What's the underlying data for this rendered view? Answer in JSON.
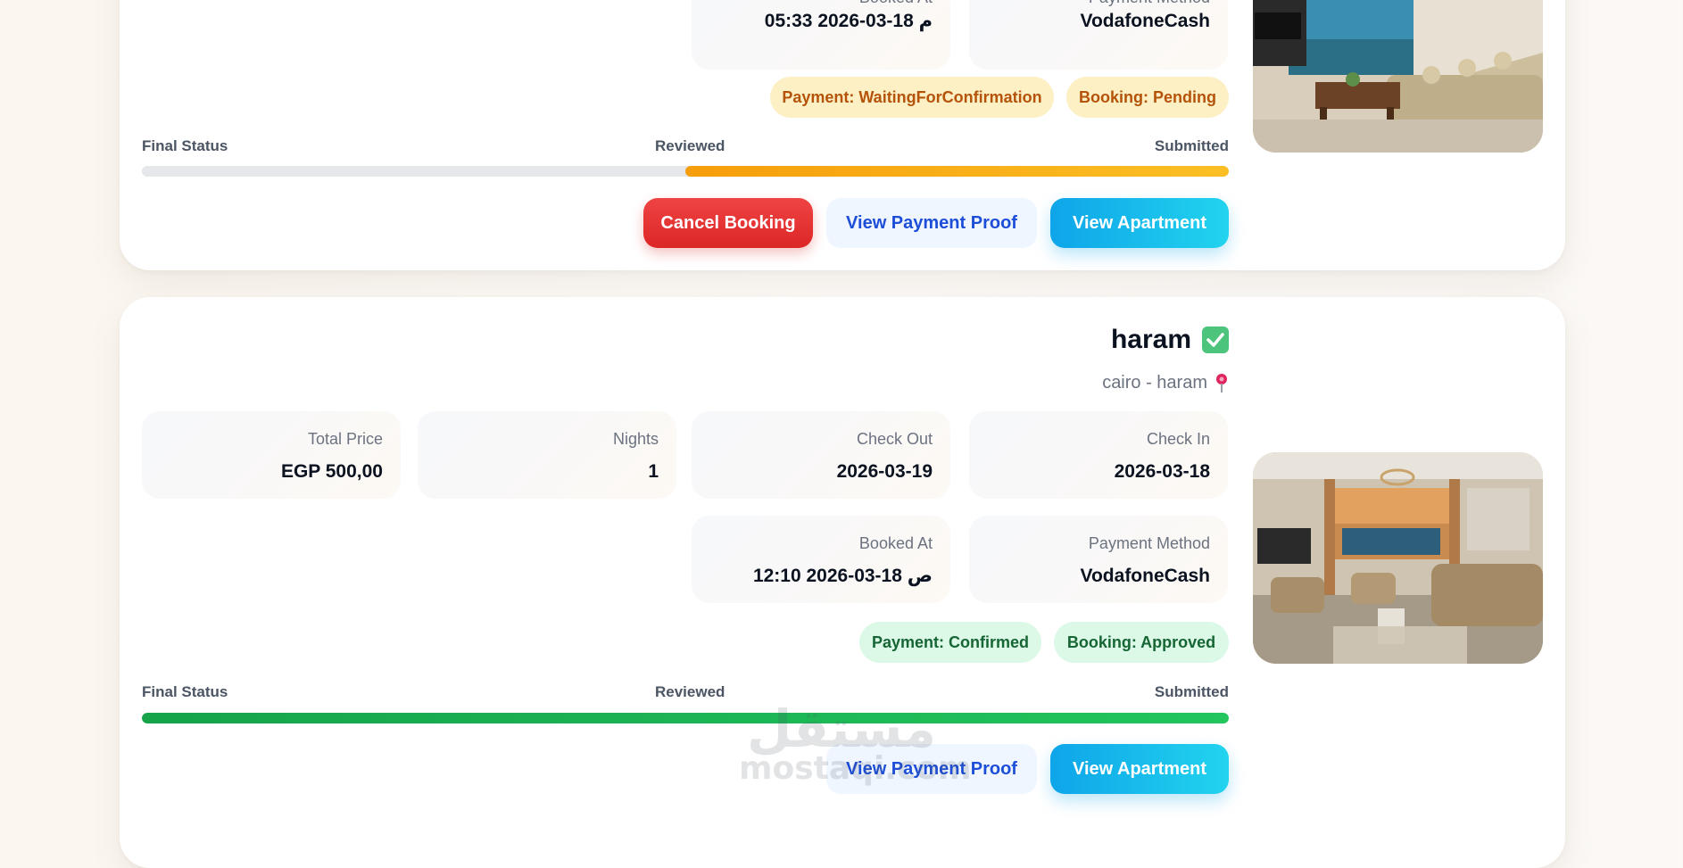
{
  "colors": {
    "amber_badge_bg": "#fdf0c4",
    "amber_badge_text": "#b45309",
    "green_badge_bg": "#dcf8e6",
    "green_badge_text": "#166534",
    "progress_amber": "#f59e0b",
    "progress_green": "#16a34a",
    "cancel_red": "#dc2626",
    "primary_cyan": "#0ea5e9",
    "secondary_blue_text": "#1d4ed8"
  },
  "booking_1": {
    "booked_at_label": "Booked At",
    "booked_at_value": "05:33 2026-03-18 م",
    "payment_method_label": "Payment Method",
    "payment_method_value": "VodafoneCash",
    "payment_badge": "Payment: WaitingForConfirmation",
    "booking_badge": "Booking: Pending",
    "steps": {
      "final": "Final Status",
      "reviewed": "Reviewed",
      "submitted": "Submitted"
    },
    "progress_fraction": 0.5,
    "cancel_label": "Cancel Booking",
    "view_proof_label": "View Payment Proof",
    "view_apartment_label": "View Apartment",
    "photo_icon": "apartment-photo"
  },
  "booking_2": {
    "title": "haram",
    "title_icon": "check-mark-icon",
    "location": "cairo - haram",
    "location_icon": "pin-icon",
    "total_price_label": "Total Price",
    "total_price_value": "EGP 500,00",
    "nights_label": "Nights",
    "nights_value": "1",
    "check_out_label": "Check Out",
    "check_out_value": "2026-03-19",
    "check_in_label": "Check In",
    "check_in_value": "2026-03-18",
    "booked_at_label": "Booked At",
    "booked_at_value": "12:10 2026-03-18 ص",
    "payment_method_label": "Payment Method",
    "payment_method_value": "VodafoneCash",
    "payment_badge": "Payment: Confirmed",
    "booking_badge": "Booking: Approved",
    "steps": {
      "final": "Final Status",
      "reviewed": "Reviewed",
      "submitted": "Submitted"
    },
    "progress_fraction": 1.0,
    "view_proof_label": "View Payment Proof",
    "view_apartment_label": "View Apartment",
    "photo_icon": "apartment-photo"
  },
  "watermark": {
    "arabic": "مستقل",
    "latin": "mostaqi.com"
  }
}
